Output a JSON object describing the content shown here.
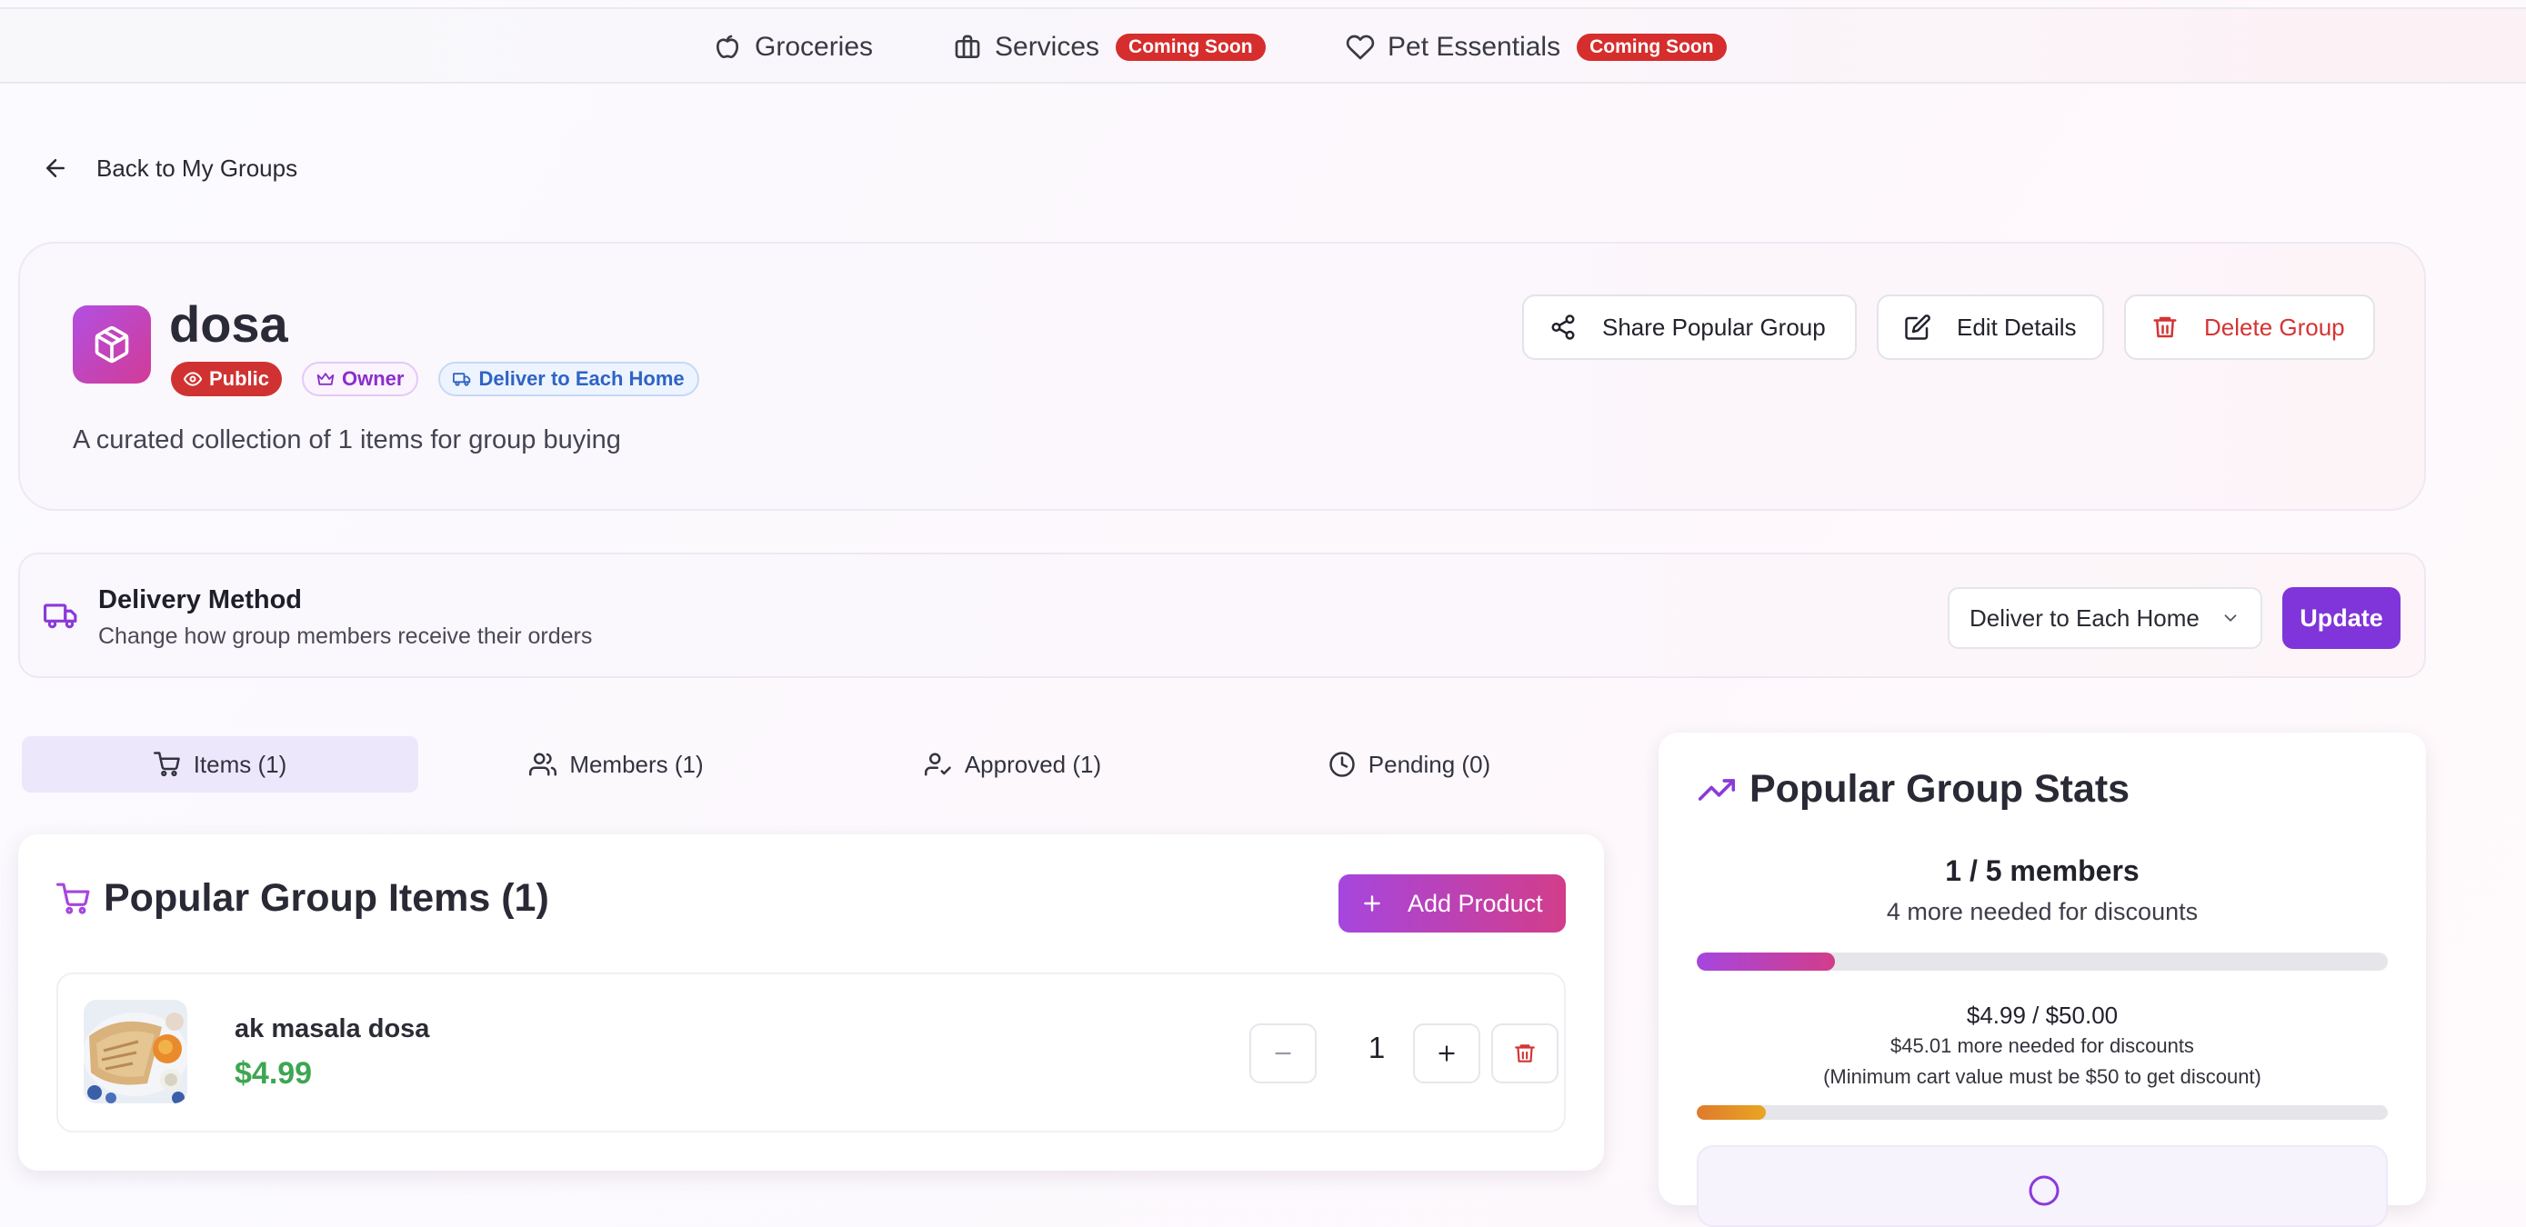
{
  "topnav": {
    "items": [
      {
        "label": "Groceries",
        "icon": "apple-icon",
        "badge": ""
      },
      {
        "label": "Services",
        "icon": "briefcase-icon",
        "badge": "Coming Soon"
      },
      {
        "label": "Pet Essentials",
        "icon": "heart-icon",
        "badge": "Coming Soon"
      }
    ]
  },
  "back": {
    "label": "Back to My Groups",
    "icon": "arrow-left-icon"
  },
  "group": {
    "title": "dosa",
    "icon": "package-icon",
    "tags": {
      "public": "Public",
      "owner": "Owner",
      "deliver": "Deliver to Each Home"
    },
    "description": "A curated collection of 1 items for group buying",
    "actions": {
      "share": "Share Popular Group",
      "edit": "Edit Details",
      "delete": "Delete Group"
    }
  },
  "delivery": {
    "title": "Delivery Method",
    "subtitle": "Change how group members receive their orders",
    "selected": "Deliver to Each Home",
    "update_label": "Update"
  },
  "tabs": [
    {
      "label": "Items (1)",
      "icon": "cart-icon",
      "active": true
    },
    {
      "label": "Members (1)",
      "icon": "users-icon",
      "active": false
    },
    {
      "label": "Approved (1)",
      "icon": "user-check-icon",
      "active": false
    },
    {
      "label": "Pending (0)",
      "icon": "clock-icon",
      "active": false
    }
  ],
  "items_panel": {
    "title": "Popular Group Items (1)",
    "add_label": "Add Product",
    "items": [
      {
        "name": "ak masala dosa",
        "price": "$4.99",
        "quantity": "1"
      }
    ]
  },
  "stats": {
    "title": "Popular Group Stats",
    "members": "1 / 5 members",
    "members_needed": "4 more needed for discounts",
    "members_progress": 0.2,
    "cart_value": "$4.99 / $50.00",
    "cart_needed": "$45.01 more needed for discounts",
    "cart_minimum": "(Minimum cart value must be $50 to get discount)",
    "cart_progress": 0.0998
  },
  "colors": {
    "accent": "#7f35d9",
    "gradient_start": "#a646de",
    "gradient_end": "#d23d8a",
    "danger": "#d43434",
    "price": "#3ea652"
  }
}
